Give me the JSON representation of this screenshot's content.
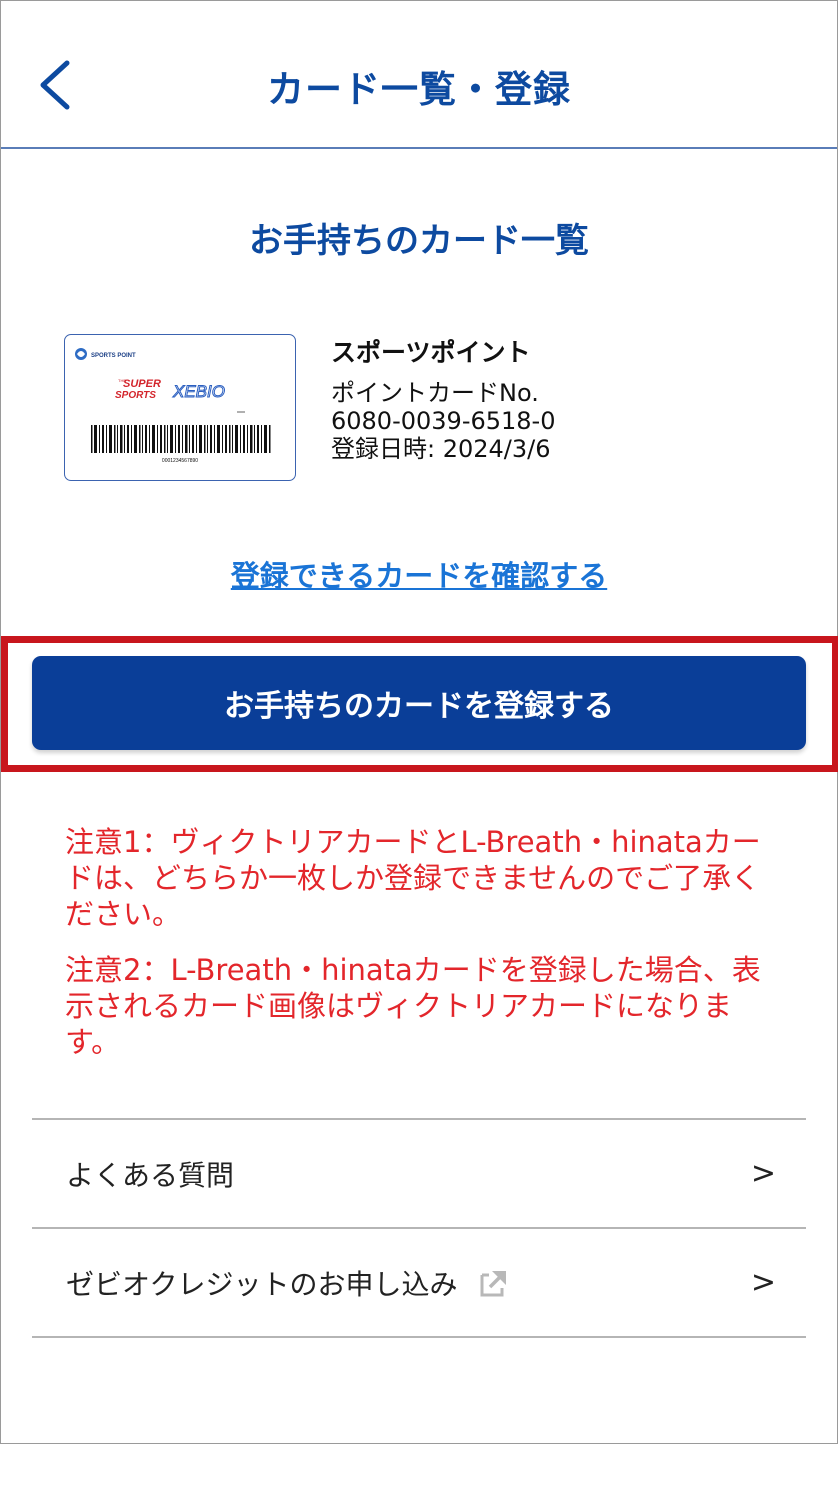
{
  "header": {
    "title": "カード一覧・登録",
    "back_icon": "chevron-left-icon"
  },
  "cards_section": {
    "title": "お手持ちのカード一覧",
    "cards": [
      {
        "name": "スポーツポイント",
        "label": "ポイントカードNo.",
        "number": "6080-0039-6518-0",
        "registered": "登録日時: 2024/3/6",
        "image": {
          "top_text": "SPORTS POINT",
          "brand_small": "THE",
          "brand_super": "SUPER",
          "brand_sports": "SPORTS",
          "brand_xebio": "XEBIO",
          "barcode_number": "0001234567890"
        }
      }
    ],
    "confirm_link": "登録できるカードを確認する"
  },
  "register_button": "お手持ちのカードを登録する",
  "notices": [
    "注意1：ヴィクトリアカードとL-Breath・hinataカードは、どちらか一枚しか登録できませんのでご了承ください。",
    "注意2：L-Breath・hinataカードを登録した場合、表示されるカード画像はヴィクトリアカードになります。"
  ],
  "menu": [
    {
      "label": "よくある質問",
      "chevron": ">"
    },
    {
      "label": "ゼビオクレジットのお申し込み",
      "chevron": ">",
      "icon": "external-link-icon"
    }
  ],
  "colors": {
    "brand_blue": "#0d4aa0",
    "button_blue": "#0a3e98",
    "link_blue": "#1a74d6",
    "notice_red": "#e3262b",
    "highlight_red": "#c8161d"
  }
}
